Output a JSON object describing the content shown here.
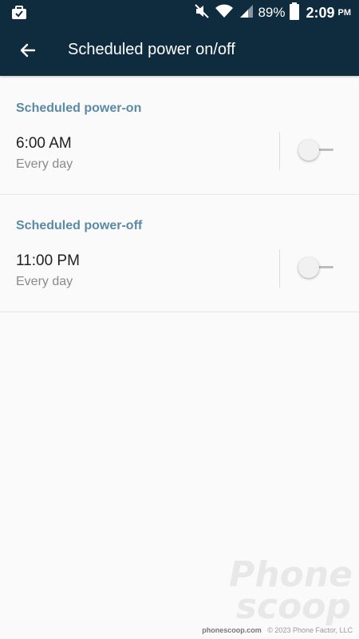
{
  "status_bar": {
    "battery_percent": "89%",
    "time": "2:09",
    "ampm": "PM"
  },
  "app_bar": {
    "title": "Scheduled power on/off"
  },
  "power_on": {
    "header": "Scheduled power-on",
    "time": "6:00 AM",
    "repeat": "Every day",
    "enabled": false
  },
  "power_off": {
    "header": "Scheduled power-off",
    "time": "11:00 PM",
    "repeat": "Every day",
    "enabled": false
  },
  "watermark": {
    "logo_line1": "Phone",
    "logo_line2": "scoop",
    "site": "phonescoop.com",
    "copyright": "© 2023 Phone Factor, LLC"
  },
  "colors": {
    "app_bar": "#0f2b3e",
    "section_header": "#5b8aa6",
    "background": "#fafafa"
  }
}
